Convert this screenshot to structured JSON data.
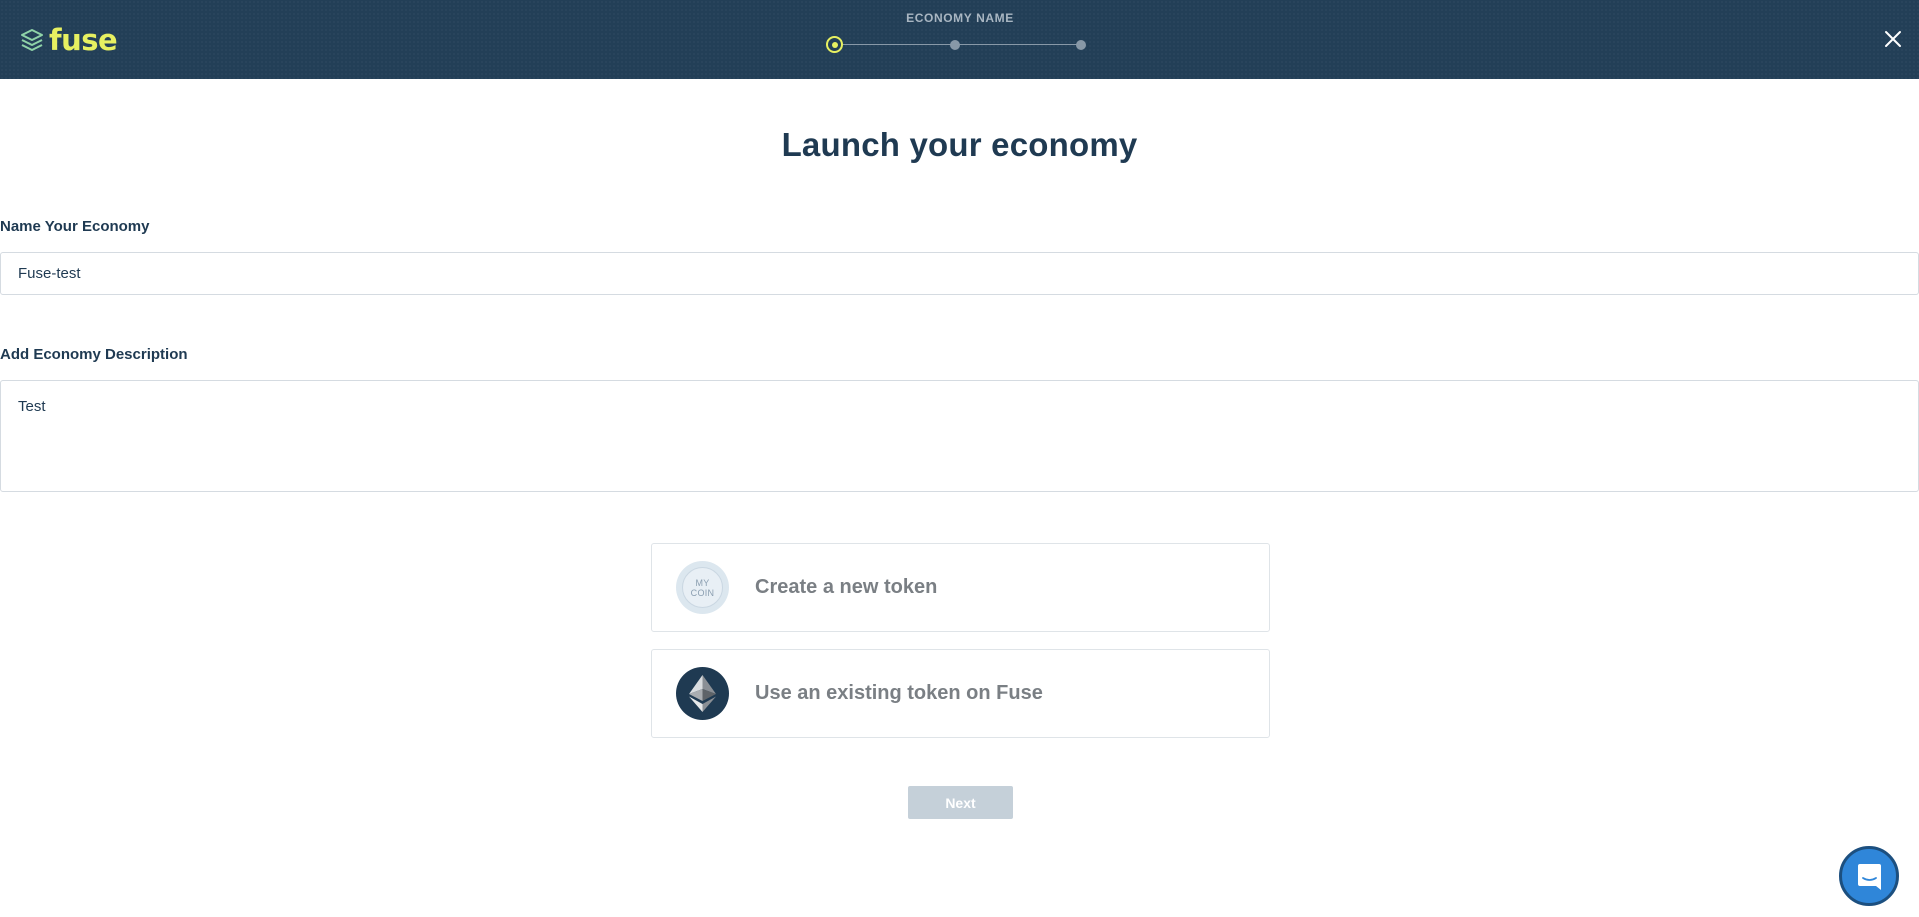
{
  "header": {
    "logo_text": "fuse",
    "stepper": {
      "label": "ECONOMY NAME",
      "steps": 3,
      "current_step": 1
    },
    "close_icon": "close-icon"
  },
  "main": {
    "title": "Launch your economy",
    "name_field": {
      "label": "Name Your Economy",
      "value": "Fuse-test"
    },
    "description_field": {
      "label": "Add Economy Description",
      "value": "Test"
    },
    "options": [
      {
        "label": "Create a new token",
        "icon": "my-coin-icon",
        "icon_text_line1": "MY",
        "icon_text_line2": "COIN"
      },
      {
        "label": "Use an existing token on Fuse",
        "icon": "ethereum-icon"
      }
    ],
    "next_button": "Next"
  },
  "colors": {
    "header_bg": "#233f57",
    "brand_accent": "#e7f061",
    "text_primary": "#1f3a52",
    "button_disabled": "#c5d0d9",
    "chat_blue": "#2f86d9"
  }
}
